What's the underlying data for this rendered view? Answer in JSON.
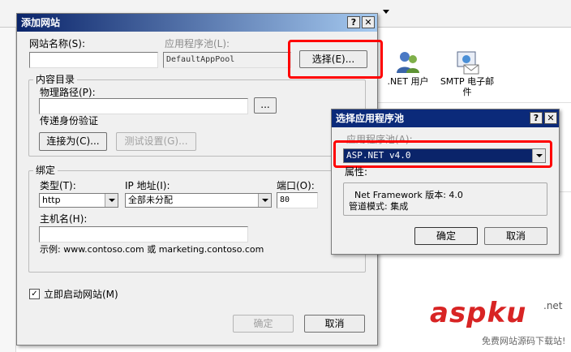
{
  "colors": {
    "title_bar": "#0b2a7a",
    "highlight": "#ff0000",
    "selection": "#0a246a",
    "watermark": "#d82424"
  },
  "background_icons": [
    {
      "label": ".NET 用户",
      "icon": "users-icon"
    },
    {
      "label": "SMTP 电子邮件",
      "icon": "email-icon"
    }
  ],
  "add_site_dialog": {
    "title": "添加网站",
    "help_label": "?",
    "close_label": "✕",
    "site_name_label": "网站名称(S):",
    "site_name_value": "",
    "app_pool_label": "应用程序池(L):",
    "app_pool_value": "DefaultAppPool",
    "select_button": "选择(E)...",
    "content_group": "内容目录",
    "physical_path_label": "物理路径(P):",
    "physical_path_value": "",
    "browse_button": "...",
    "pass_auth_label": "传递身份验证",
    "connect_as_button": "连接为(C)...",
    "test_settings_button": "测试设置(G)...",
    "binding_group": "绑定",
    "type_label": "类型(T):",
    "type_value": "http",
    "ip_label": "IP 地址(I):",
    "ip_value": "全部未分配",
    "port_label": "端口(O):",
    "port_value": "80",
    "hostname_label": "主机名(H):",
    "hostname_value": "",
    "example_text": "示例: www.contoso.com 或 marketing.contoso.com",
    "start_checkbox_label": "立即启动网站(M)",
    "start_checked": true,
    "ok_button": "确定",
    "cancel_button": "取消"
  },
  "pool_dialog": {
    "title": "选择应用程序池",
    "help_label": "?",
    "close_label": "✕",
    "pool_label": "应用程序池(A):",
    "pool_value": "ASP.NET v4.0",
    "properties_label": "属性:",
    "framework_line": "Net Framework 版本: 4.0",
    "pipeline_line": "管道模式: 集成",
    "ok_button": "确定",
    "cancel_button": "取消"
  },
  "watermark": {
    "brand": "aspku",
    "domain": ".net",
    "tagline": "免费网站源码下载站!"
  }
}
